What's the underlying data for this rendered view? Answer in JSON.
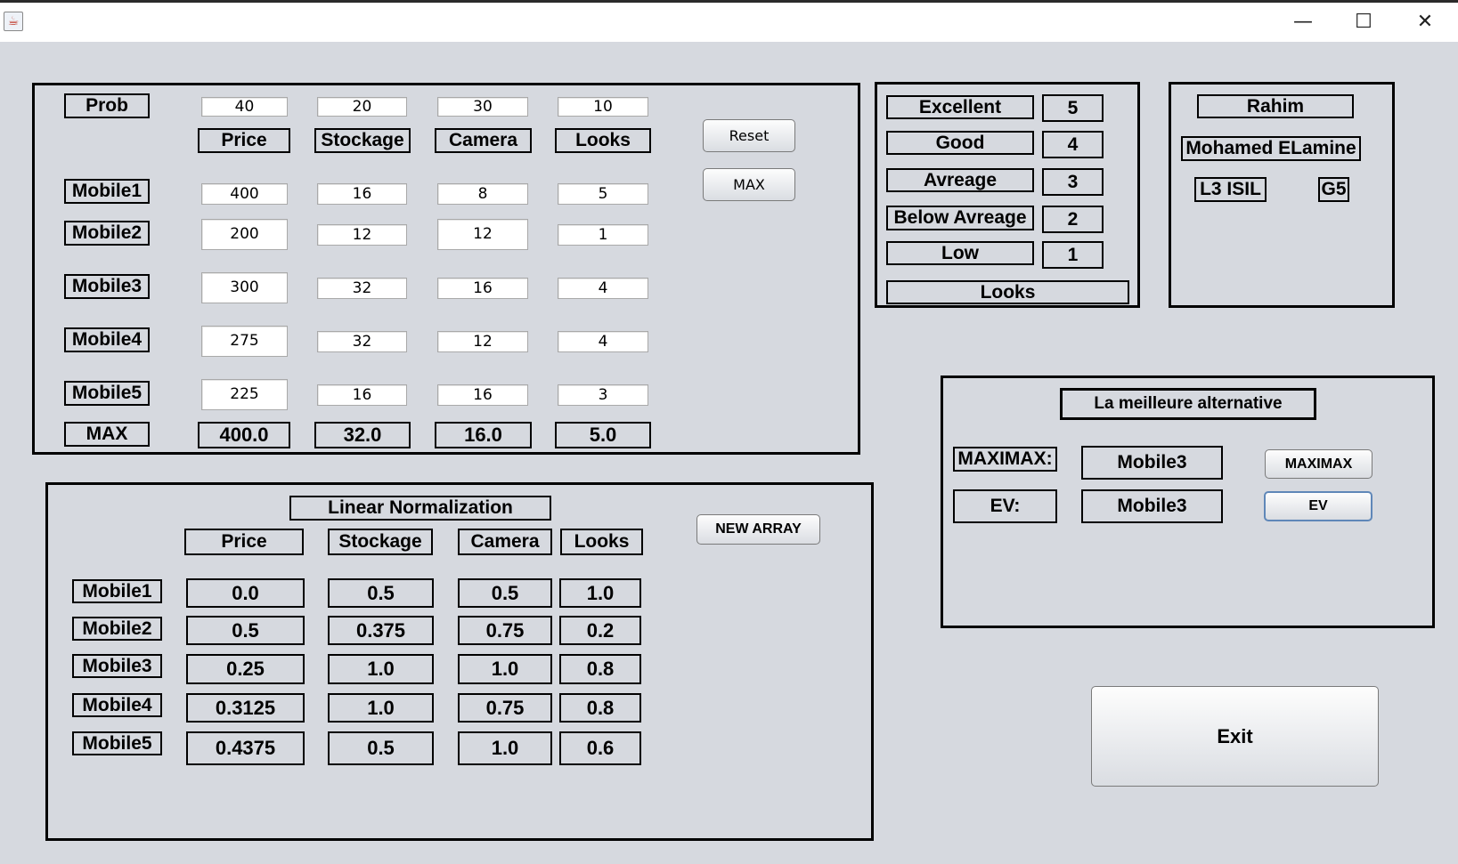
{
  "window": {
    "minimize_glyph": "—",
    "maximize_glyph": "☐",
    "close_glyph": "✕"
  },
  "top_panel": {
    "prob_label": "Prob",
    "prob_values": [
      "40",
      "20",
      "30",
      "10"
    ],
    "headers": [
      "Price",
      "Stockage",
      "Camera",
      "Looks"
    ],
    "rows": [
      {
        "label": "Mobile1",
        "values": [
          "400",
          "16",
          "8",
          "5"
        ]
      },
      {
        "label": "Mobile2",
        "values": [
          "200",
          "12",
          "12",
          "1"
        ]
      },
      {
        "label": "Mobile3",
        "values": [
          "300",
          "32",
          "16",
          "4"
        ]
      },
      {
        "label": "Mobile4",
        "values": [
          "275",
          "32",
          "12",
          "4"
        ]
      },
      {
        "label": "Mobile5",
        "values": [
          "225",
          "16",
          "16",
          "3"
        ]
      }
    ],
    "max_label": "MAX",
    "max_values": [
      "400.0",
      "32.0",
      "16.0",
      "5.0"
    ],
    "reset_button": "Reset",
    "max_button": "MAX"
  },
  "looks_panel": {
    "scale": [
      {
        "label": "Excellent",
        "value": "5"
      },
      {
        "label": "Good",
        "value": "4"
      },
      {
        "label": "Avreage",
        "value": "3"
      },
      {
        "label": "Below Avreage",
        "value": "2"
      },
      {
        "label": "Low",
        "value": "1"
      }
    ],
    "footer": "Looks"
  },
  "author_panel": {
    "first_name": "Rahim",
    "full_name": "Mohamed ELamine",
    "level": "L3 ISIL",
    "group": "G5"
  },
  "normalization_panel": {
    "title": "Linear Normalization",
    "new_array_button": "NEW ARRAY",
    "headers": [
      "Price",
      "Stockage",
      "Camera",
      "Looks"
    ],
    "rows": [
      {
        "label": "Mobile1",
        "values": [
          "0.0",
          "0.5",
          "0.5",
          "1.0"
        ]
      },
      {
        "label": "Mobile2",
        "values": [
          "0.5",
          "0.375",
          "0.75",
          "0.2"
        ]
      },
      {
        "label": "Mobile3",
        "values": [
          "0.25",
          "1.0",
          "1.0",
          "0.8"
        ]
      },
      {
        "label": "Mobile4",
        "values": [
          "0.3125",
          "1.0",
          "0.75",
          "0.8"
        ]
      },
      {
        "label": "Mobile5",
        "values": [
          "0.4375",
          "0.5",
          "1.0",
          "0.6"
        ]
      }
    ]
  },
  "best_panel": {
    "title": "La meilleure alternative",
    "maximax_label": "MAXIMAX:",
    "maximax_result": "Mobile3",
    "maximax_button": "MAXIMAX",
    "ev_label": "EV:",
    "ev_result": "Mobile3",
    "ev_button": "EV"
  },
  "exit_button": "Exit"
}
